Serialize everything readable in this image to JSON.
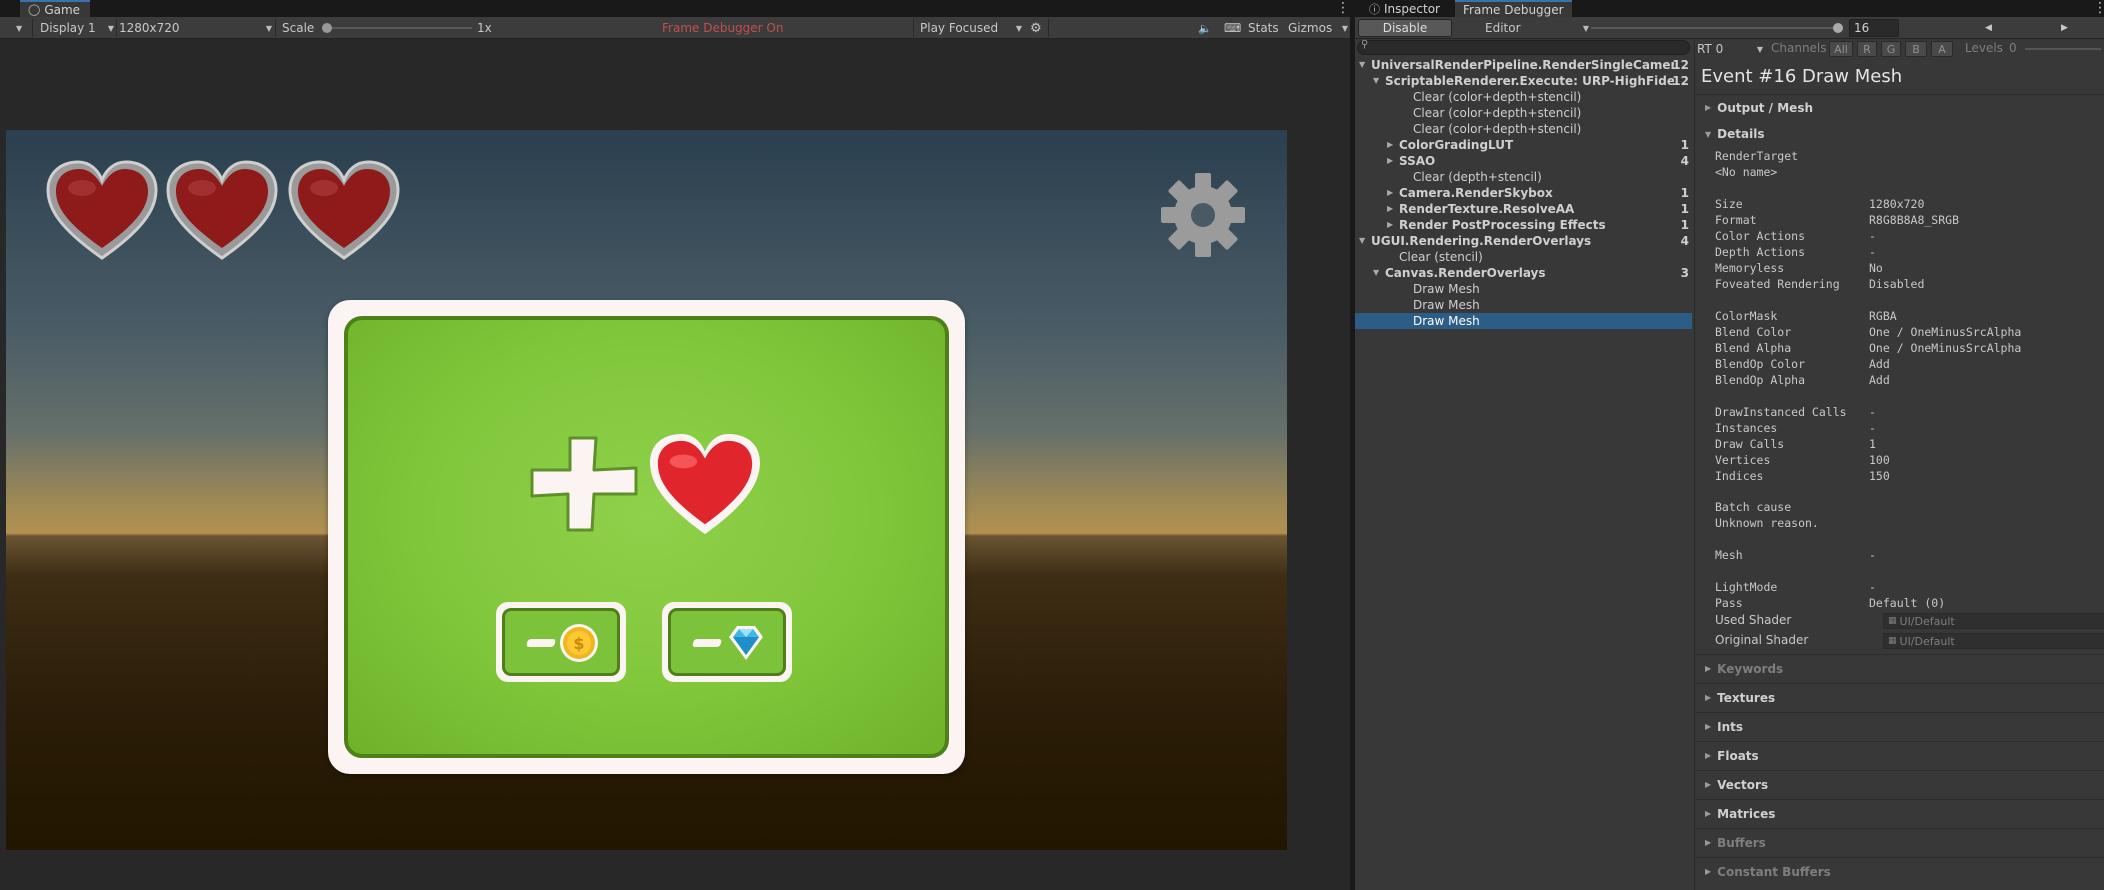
{
  "game": {
    "tab_label": "Game",
    "display": "Display 1",
    "resolution": "1280x720",
    "scale_label": "Scale",
    "scale_value": "1x",
    "frame_debugger_status": "Frame Debugger On",
    "play_mode": "Play Focused",
    "stats_label": "Stats",
    "gizmos_label": "Gizmos"
  },
  "inspector": {
    "tab_inspector": "Inspector",
    "tab_frame_debugger": "Frame Debugger",
    "disable_label": "Disable",
    "target": "Editor",
    "event_index": "16",
    "rt_label": "RT 0",
    "channels_label": "Channels",
    "channels": [
      "All",
      "R",
      "G",
      "B",
      "A"
    ],
    "levels_label": "Levels",
    "levels_value": "0"
  },
  "tree": [
    {
      "label": "UniversalRenderPipeline.RenderSingleCameraInterr",
      "count": "12",
      "bold": true,
      "indent": 0,
      "expand": "down"
    },
    {
      "label": "ScriptableRenderer.Execute: URP-HighFidelity-R",
      "count": "12",
      "bold": true,
      "indent": 1,
      "expand": "down"
    },
    {
      "label": "Clear (color+depth+stencil)",
      "count": "",
      "bold": false,
      "indent": 3,
      "expand": ""
    },
    {
      "label": "Clear (color+depth+stencil)",
      "count": "",
      "bold": false,
      "indent": 3,
      "expand": ""
    },
    {
      "label": "Clear (color+depth+stencil)",
      "count": "",
      "bold": false,
      "indent": 3,
      "expand": ""
    },
    {
      "label": "ColorGradingLUT",
      "count": "1",
      "bold": true,
      "indent": 2,
      "expand": "right"
    },
    {
      "label": "SSAO",
      "count": "4",
      "bold": true,
      "indent": 2,
      "expand": "right"
    },
    {
      "label": "Clear (depth+stencil)",
      "count": "",
      "bold": false,
      "indent": 3,
      "expand": ""
    },
    {
      "label": "Camera.RenderSkybox",
      "count": "1",
      "bold": true,
      "indent": 2,
      "expand": "right"
    },
    {
      "label": "RenderTexture.ResolveAA",
      "count": "1",
      "bold": true,
      "indent": 2,
      "expand": "right"
    },
    {
      "label": "Render PostProcessing Effects",
      "count": "1",
      "bold": true,
      "indent": 2,
      "expand": "right"
    },
    {
      "label": "UGUI.Rendering.RenderOverlays",
      "count": "4",
      "bold": true,
      "indent": 0,
      "expand": "down"
    },
    {
      "label": "Clear (stencil)",
      "count": "",
      "bold": false,
      "indent": 2,
      "expand": ""
    },
    {
      "label": "Canvas.RenderOverlays",
      "count": "3",
      "bold": true,
      "indent": 1,
      "expand": "down"
    },
    {
      "label": "Draw Mesh",
      "count": "",
      "bold": false,
      "indent": 3,
      "expand": ""
    },
    {
      "label": "Draw Mesh",
      "count": "",
      "bold": false,
      "indent": 3,
      "expand": ""
    },
    {
      "label": "Draw Mesh",
      "count": "",
      "bold": false,
      "indent": 3,
      "expand": "",
      "selected": true
    }
  ],
  "detail": {
    "title": "Event #16 Draw Mesh",
    "output_mesh": "Output / Mesh",
    "details": "Details",
    "render_target_label": "RenderTarget",
    "render_target_value": "<No name>",
    "props": [
      {
        "k": "Size",
        "v": "1280x720"
      },
      {
        "k": "Format",
        "v": "R8G8B8A8_SRGB"
      },
      {
        "k": "Color Actions",
        "v": "-"
      },
      {
        "k": "Depth Actions",
        "v": "-"
      },
      {
        "k": "Memoryless",
        "v": "No"
      },
      {
        "k": "Foveated Rendering",
        "v": "Disabled"
      },
      {
        "k": "",
        "v": ""
      },
      {
        "k": "ColorMask",
        "v": "RGBA"
      },
      {
        "k": "Blend Color",
        "v": "One / OneMinusSrcAlpha"
      },
      {
        "k": "Blend Alpha",
        "v": "One / OneMinusSrcAlpha"
      },
      {
        "k": "BlendOp Color",
        "v": "Add"
      },
      {
        "k": "BlendOp Alpha",
        "v": "Add"
      },
      {
        "k": "",
        "v": ""
      },
      {
        "k": "DrawInstanced Calls",
        "v": "-"
      },
      {
        "k": "Instances",
        "v": "-"
      },
      {
        "k": "Draw Calls",
        "v": "1"
      },
      {
        "k": "Vertices",
        "v": "100"
      },
      {
        "k": "Indices",
        "v": "150"
      }
    ],
    "batch_cause_label": "Batch cause",
    "batch_cause_value": "Unknown reason.",
    "mesh_label": "Mesh",
    "mesh_value": "-",
    "lightmode_label": "LightMode",
    "lightmode_value": "-",
    "pass_label": "Pass",
    "pass_value": "Default (0)",
    "used_shader_label": "Used Shader",
    "used_shader_value": "UI/Default",
    "original_shader_label": "Original Shader",
    "original_shader_value": "UI/Default",
    "sections": [
      {
        "label": "Keywords",
        "dim": true
      },
      {
        "label": "Textures",
        "dim": false
      },
      {
        "label": "Ints",
        "dim": false
      },
      {
        "label": "Floats",
        "dim": false
      },
      {
        "label": "Vectors",
        "dim": false
      },
      {
        "label": "Matrices",
        "dim": false
      },
      {
        "label": "Buffers",
        "dim": true
      },
      {
        "label": "Constant Buffers",
        "dim": true
      }
    ]
  },
  "colors": {
    "accent": "#2c5d87",
    "frame_debugger_on": "#c0504d",
    "card_green": "#80c63a",
    "heart_red": "#8e1a1a"
  }
}
